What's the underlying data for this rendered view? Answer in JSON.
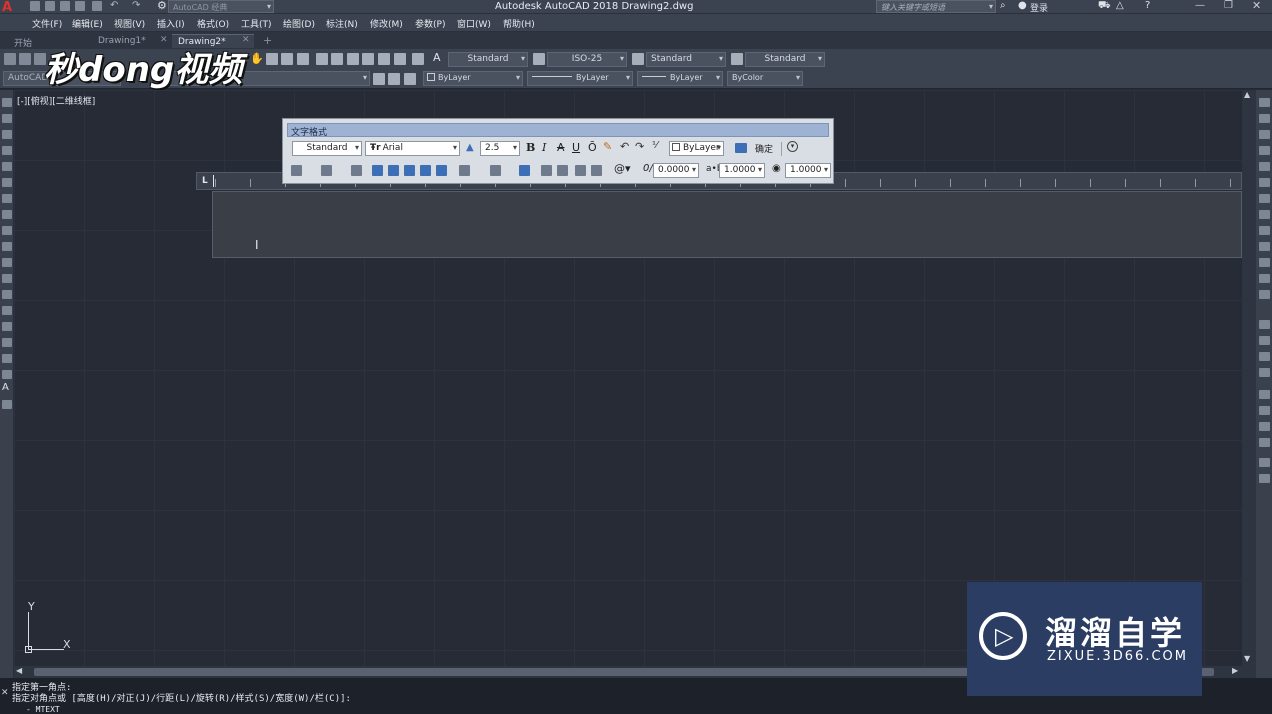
{
  "window": {
    "title": "Autodesk AutoCAD 2018    Drawing2.dwg",
    "search_placeholder": "键入关键字或短语",
    "login": "登录",
    "workspace": "AutoCAD 经典"
  },
  "menu": [
    "文件(F)",
    "编辑(E)",
    "视图(V)",
    "插入(I)",
    "格式(O)",
    "工具(T)",
    "绘图(D)",
    "标注(N)",
    "修改(M)",
    "参数(P)",
    "窗口(W)",
    "帮助(H)"
  ],
  "tabs": [
    {
      "label": "开始",
      "active": false
    },
    {
      "label": "Drawing1*",
      "active": false
    },
    {
      "label": "Drawing2*",
      "active": true
    }
  ],
  "toolbar": {
    "text_style": "Standard",
    "dim_style": "ISO-25",
    "table_style": "Standard",
    "mleader_style": "Standard",
    "workspace_combo": "AutoCAD",
    "layer_combo": "ByLayer",
    "linetype_combo": "ByLayer",
    "lineweight_combo": "ByLayer",
    "color_combo": "ByColor"
  },
  "viewport_label": "[-][俯视][二维线框]",
  "text_format": {
    "title": "文字格式",
    "style": "Standard",
    "font": "Arial",
    "font_prefix": "Ŧr",
    "height": "2.5",
    "color": "ByLayer",
    "ok": "确定",
    "oblique": "0.0000",
    "tracking": "1.0000",
    "width_factor": "1.0000",
    "btn_bold": "B",
    "btn_italic": "I",
    "btn_strike": "A",
    "btn_underline": "U",
    "btn_overline": "Ō",
    "ruler_marker": "L"
  },
  "ucs": {
    "y": "Y",
    "x": "X"
  },
  "command": {
    "line1": "指定第一角点:",
    "line2": "指定对角点或 [高度(H)/对正(J)/行距(L)/旋转(R)/样式(S)/宽度(W)/栏(C)]:",
    "line3": "- MTEXT"
  },
  "watermark": {
    "brand_cn": "溜溜自学",
    "brand_en": "ZIXUE.3D66.COM"
  },
  "logo": {
    "text": "秒dong视频"
  }
}
